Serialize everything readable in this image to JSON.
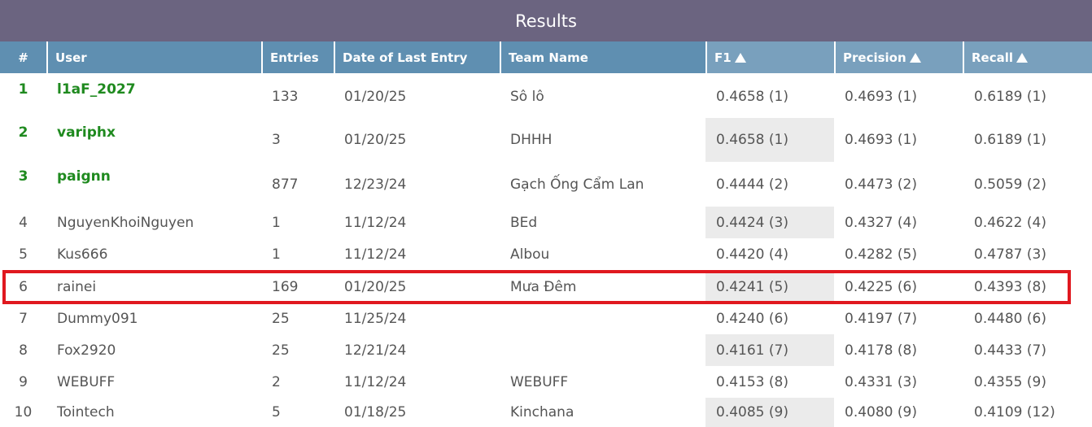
{
  "title": "Results",
  "columns": {
    "rank": "#",
    "user": "User",
    "entries": "Entries",
    "date": "Date of Last Entry",
    "team": "Team Name",
    "f1": "F1",
    "precision": "Precision",
    "recall": "Recall"
  },
  "rows": [
    {
      "rank": "1",
      "user": "l1aF_2027",
      "entries": "133",
      "date": "01/20/25",
      "team": "Sô lô",
      "f1": "0.4658 (1)",
      "precision": "0.4693 (1)",
      "recall": "0.6189 (1)"
    },
    {
      "rank": "2",
      "user": "variphx",
      "entries": "3",
      "date": "01/20/25",
      "team": "DHHH",
      "f1": "0.4658 (1)",
      "precision": "0.4693 (1)",
      "recall": "0.6189 (1)"
    },
    {
      "rank": "3",
      "user": "paignn",
      "entries": "877",
      "date": "12/23/24",
      "team": "Gạch Ống Cẩm Lan",
      "f1": "0.4444 (2)",
      "precision": "0.4473 (2)",
      "recall": "0.5059 (2)"
    },
    {
      "rank": "4",
      "user": "NguyenKhoiNguyen",
      "entries": "1",
      "date": "11/12/24",
      "team": "BEd",
      "f1": "0.4424 (3)",
      "precision": "0.4327 (4)",
      "recall": "0.4622 (4)"
    },
    {
      "rank": "5",
      "user": "Kus666",
      "entries": "1",
      "date": "11/12/24",
      "team": "Albou",
      "f1": "0.4420 (4)",
      "precision": "0.4282 (5)",
      "recall": "0.4787 (3)"
    },
    {
      "rank": "6",
      "user": "rainei",
      "entries": "169",
      "date": "01/20/25",
      "team": "Mưa Đêm",
      "f1": "0.4241 (5)",
      "precision": "0.4225 (6)",
      "recall": "0.4393 (8)"
    },
    {
      "rank": "7",
      "user": "Dummy091",
      "entries": "25",
      "date": "11/25/24",
      "team": "",
      "f1": "0.4240 (6)",
      "precision": "0.4197 (7)",
      "recall": "0.4480 (6)"
    },
    {
      "rank": "8",
      "user": "Fox2920",
      "entries": "25",
      "date": "12/21/24",
      "team": "",
      "f1": "0.4161 (7)",
      "precision": "0.4178 (8)",
      "recall": "0.4433 (7)"
    },
    {
      "rank": "9",
      "user": "WEBUFF",
      "entries": "2",
      "date": "11/12/24",
      "team": "WEBUFF",
      "f1": "0.4153 (8)",
      "precision": "0.4331 (3)",
      "recall": "0.4355 (9)"
    },
    {
      "rank": "10",
      "user": "Tointech",
      "entries": "5",
      "date": "01/18/25",
      "team": "Kinchana",
      "f1": "0.4085 (9)",
      "precision": "0.4080 (9)",
      "recall": "0.4109 (12)"
    }
  ],
  "colors": {
    "title_bg": "#6b6480",
    "header_bg": "#5f8fb1",
    "sorted_header_bg": "#79a0bd",
    "top_rank_text": "#1f8a1f",
    "highlight_border": "#e0181f",
    "f1_shade": "#ebebeb"
  }
}
